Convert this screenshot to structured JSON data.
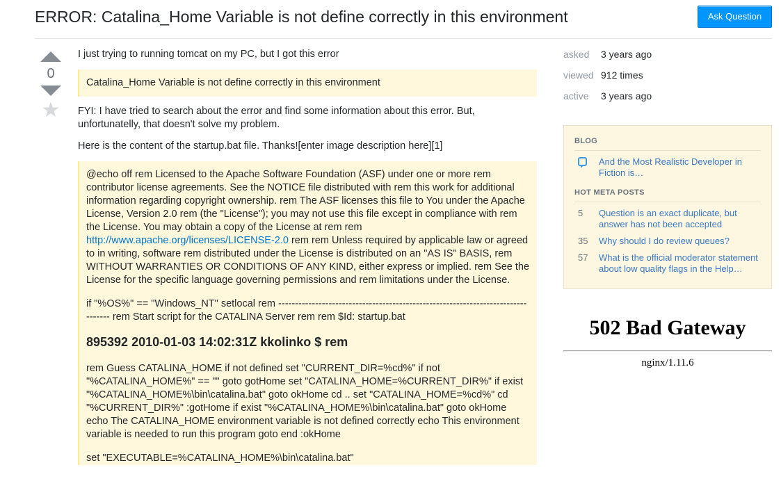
{
  "header": {
    "title": "ERROR: Catalina_Home Variable is not define correctly in this environment",
    "ask_button": "Ask Question"
  },
  "vote": {
    "count": "0",
    "up_icon": "arrow-up-icon",
    "down_icon": "arrow-down-icon",
    "favorite_icon": "star-icon"
  },
  "post": {
    "intro": "I just trying to running tomcat on my PC, but I got this error",
    "error_quote": "Catalina_Home Variable is not define correctly in this environment",
    "fyi": "FYI: I have tried to search about the error and find some information about this error. But, unfortunatelly, that doesn't solve my problem.",
    "content_line": "Here is the content of the startup.bat file. Thanks![enter image description here][1]",
    "code": {
      "license_before_link": "@echo off rem Licensed to the Apache Software Foundation (ASF) under one or more rem contributor license agreements. See the NOTICE file distributed with rem this work for additional information regarding copyright ownership. rem The ASF licenses this file to You under the Apache License, Version 2.0 rem (the \"License\"); you may not use this file except in compliance with rem the License. You may obtain a copy of the License at rem rem ",
      "license_link": "http://www.apache.org/licenses/LICENSE-2.0",
      "license_after_link": " rem rem Unless required by applicable law or agreed to in writing, software rem distributed under the License is distributed on an \"AS IS\" BASIS, rem WITHOUT WARRANTIES OR CONDITIONS OF ANY KIND, either express or implied. rem See the License for the specific language governing permissions and rem limitations under the License.",
      "if_line": "if \"%OS%\" == \"Windows_NT\" setlocal rem --------------------------------------------------------------------------------- rem Start script for the CATALINA Server rem rem $Id: startup.bat",
      "heading": "895392 2010-01-03 14:02:31Z kkolinko $ rem",
      "guess_block": "rem Guess CATALINA_HOME if not defined set \"CURRENT_DIR=%cd%\" if not \"%CATALINA_HOME%\" == \"\" goto gotHome set \"CATALINA_HOME=%CURRENT_DIR%\" if exist \"%CATALINA_HOME%\\bin\\catalina.bat\" goto okHome cd .. set \"CATALINA_HOME=%cd%\" cd \"%CURRENT_DIR%\" :gotHome if exist \"%CATALINA_HOME%\\bin\\catalina.bat\" goto okHome echo The CATALINA_HOME environment variable is not defined correctly echo This environment variable is needed to run this program goto end :okHome",
      "executable_line": "set \"EXECUTABLE=%CATALINA_HOME%\\bin\\catalina.bat\""
    }
  },
  "stats": [
    {
      "label": "asked",
      "value": "3 years ago"
    },
    {
      "label": "viewed",
      "value": "912 times"
    },
    {
      "label": "active",
      "value": "3 years ago"
    }
  ],
  "widget": {
    "blog_header": "BLOG",
    "blog_items": [
      {
        "icon": "blog-bubble-icon",
        "text": "And the Most Realistic Developer in Fiction is…"
      }
    ],
    "meta_header": "HOT META POSTS",
    "meta_items": [
      {
        "count": "5",
        "text": "Question is an exact duplicate, but answer has not been accepted"
      },
      {
        "count": "35",
        "text": "Why should I do review queues?"
      },
      {
        "count": "57",
        "text": "What is the official moderator statement about low quality flags in the Help…"
      }
    ]
  },
  "gateway": {
    "title": "502 Bad Gateway",
    "server": "nginx/1.11.6"
  },
  "colors": {
    "accent": "#0095ff",
    "link": "#3a78c3",
    "quote_bg": "#fff8dc",
    "widget_bg": "#fdf7e2"
  }
}
